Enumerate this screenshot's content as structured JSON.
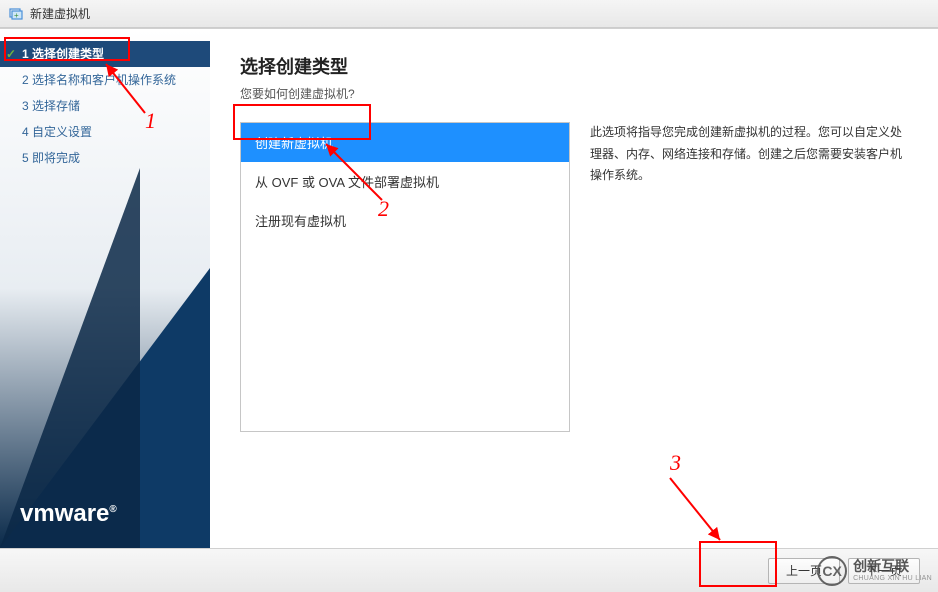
{
  "titlebar": {
    "title": "新建虚拟机"
  },
  "sidebar": {
    "steps": [
      {
        "num": "1",
        "label": "选择创建类型"
      },
      {
        "num": "2",
        "label": "选择名称和客户机操作系统"
      },
      {
        "num": "3",
        "label": "选择存储"
      },
      {
        "num": "4",
        "label": "自定义设置"
      },
      {
        "num": "5",
        "label": "即将完成"
      }
    ],
    "logo": "vmware",
    "logo_reg": "®"
  },
  "main": {
    "title": "选择创建类型",
    "subtitle": "您要如何创建虚拟机?",
    "options": [
      "创建新虚拟机",
      "从 OVF 或 OVA 文件部署虚拟机",
      "注册现有虚拟机"
    ],
    "description": "此选项将指导您完成创建新虚拟机的过程。您可以自定义处理器、内存、网络连接和存储。创建之后您需要安装客户机操作系统。"
  },
  "footer": {
    "prev": "上一页",
    "next": "下一页"
  },
  "annotations": {
    "n1": "1",
    "n2": "2",
    "n3": "3"
  },
  "watermark": {
    "logo_text": "CX",
    "cn": "创新互联",
    "en": "CHUANG XIN HU LIAN"
  }
}
